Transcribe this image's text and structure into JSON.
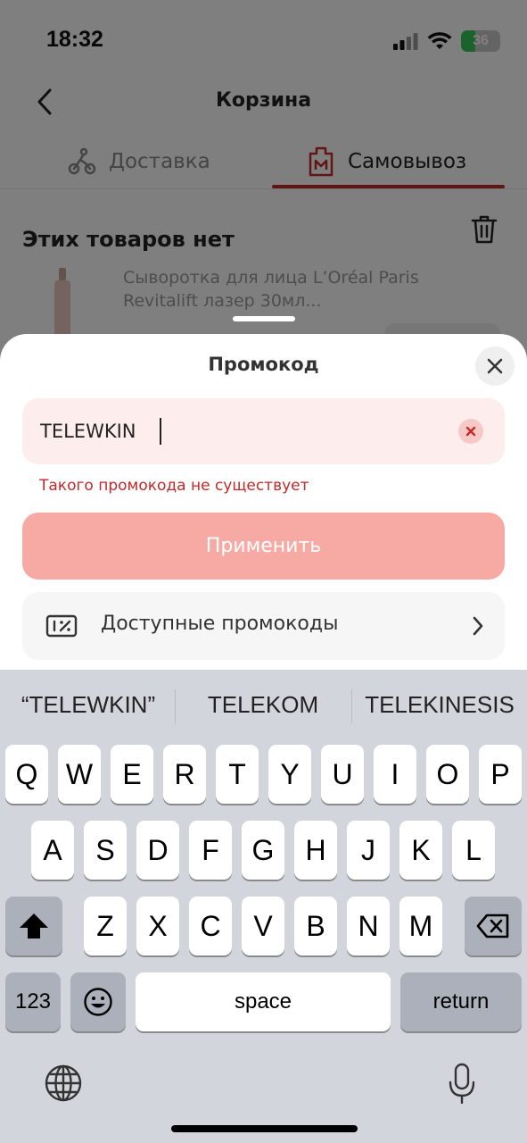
{
  "status_bar": {
    "time": "18:32",
    "battery": "36",
    "icons": [
      "signal-icon",
      "wifi-icon",
      "battery-charging-icon"
    ]
  },
  "header": {
    "title": "Корзина",
    "back_icon": "chevron-left-icon"
  },
  "tabs": [
    {
      "label": "Доставка",
      "icon": "courier-bike-icon",
      "active": false
    },
    {
      "label": "Самовывоз",
      "icon": "pickup-bag-icon",
      "active": true
    }
  ],
  "unavailable": {
    "title": "Этих товаров нет",
    "delete_icon": "trash-icon",
    "product_name": "Сыворотка для лица L’Oréal Paris Revitalift лазер 30мл..."
  },
  "promo_sheet": {
    "title": "Промокод",
    "close_icon": "close-icon",
    "input_value": "TELEWKIN",
    "clear_icon": "clear-x-icon",
    "error": "Такого промокода не существует",
    "apply_label": "Применить",
    "available_label": "Доступные промокоды",
    "available_icon": "discount-coupon-icon"
  },
  "keyboard": {
    "suggestions": [
      "“TELEWKIN”",
      "TELEKOM",
      "TELEKINESIS"
    ],
    "row1": [
      "Q",
      "W",
      "E",
      "R",
      "T",
      "Y",
      "U",
      "I",
      "O",
      "P"
    ],
    "row2": [
      "A",
      "S",
      "D",
      "F",
      "G",
      "H",
      "J",
      "K",
      "L"
    ],
    "row3": [
      "Z",
      "X",
      "C",
      "V",
      "B",
      "N",
      "M"
    ],
    "numbers_label": "123",
    "space_label": "space",
    "return_label": "return",
    "shift_icon": "shift-icon",
    "backspace_icon": "backspace-icon",
    "emoji_icon": "emoji-icon",
    "globe_icon": "globe-icon",
    "mic_icon": "microphone-icon"
  },
  "colors": {
    "accent": "#c62828",
    "apply_button": "#f7aaa4",
    "field_bg": "#fdeeed"
  }
}
